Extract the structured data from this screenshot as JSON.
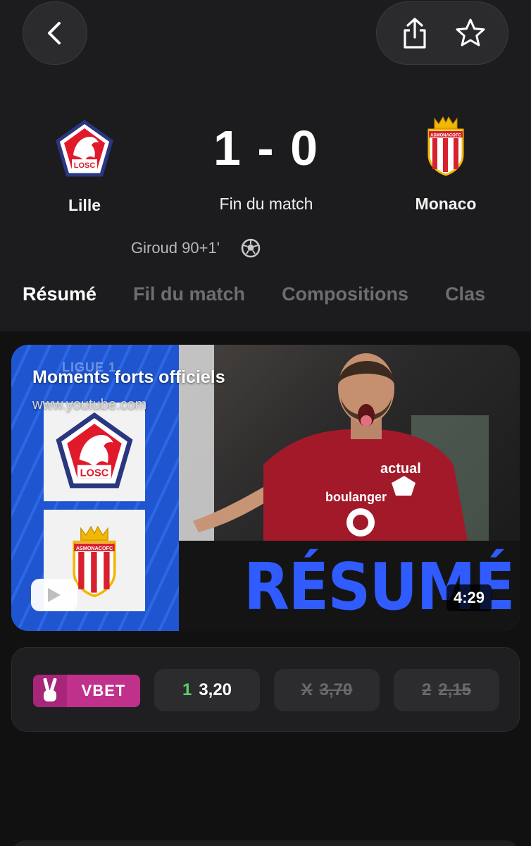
{
  "nav": {
    "back_icon": "chevron-left-icon",
    "share_icon": "share-icon",
    "favorite_icon": "star-icon"
  },
  "match": {
    "home": {
      "name": "Lille",
      "logo_text": "LOSC"
    },
    "away": {
      "name": "Monaco",
      "logo_text": "ASMONACOFC"
    },
    "score": "1 - 0",
    "status": "Fin du match",
    "scorer": "Giroud 90+1'",
    "scorer_icon": "soccer-ball-icon"
  },
  "tabs": [
    {
      "label": "Résumé",
      "active": true
    },
    {
      "label": "Fil du match",
      "active": false
    },
    {
      "label": "Compositions",
      "active": false
    },
    {
      "label": "Clas",
      "active": false
    }
  ],
  "video": {
    "title": "Moments forts officiels",
    "source": "www.youtube.com",
    "league": "LIGUE 1",
    "overlay_word": "RÉSUMÉ",
    "duration": "4:29",
    "home_logo_text": "LOSC",
    "away_logo_text": "ASMONACOFC",
    "sponsor_top": "actual",
    "sponsor_chest": "boulanger",
    "play_icon": "youtube-play-icon"
  },
  "odds": {
    "bookmaker": "VBET",
    "items": [
      {
        "key": "1",
        "value": "3,20",
        "enabled": true
      },
      {
        "key": "X",
        "value": "3,70",
        "enabled": false
      },
      {
        "key": "2",
        "value": "2,15",
        "enabled": false
      }
    ]
  },
  "colors": {
    "background": "#1c1c1e",
    "content_background": "#111112",
    "accent_green": "#5ad06b",
    "vbet_brand": "#c0318c",
    "resume_blue": "#2f5bff",
    "lille_red": "#e11a2b",
    "monaco_red": "#d8202e"
  }
}
